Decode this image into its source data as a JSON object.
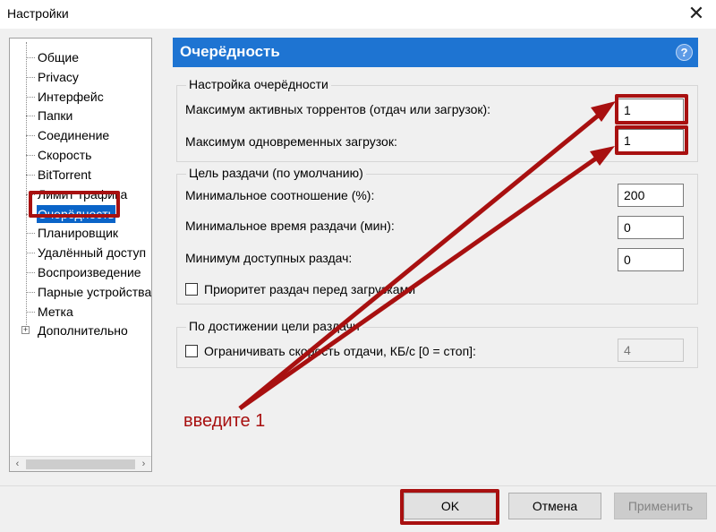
{
  "window": {
    "title": "Настройки",
    "close_glyph": "✕"
  },
  "tree": {
    "items": [
      {
        "label": "Общие",
        "selected": false
      },
      {
        "label": "Privacy",
        "selected": false
      },
      {
        "label": "Интерфейс",
        "selected": false
      },
      {
        "label": "Папки",
        "selected": false
      },
      {
        "label": "Соединение",
        "selected": false
      },
      {
        "label": "Скорость",
        "selected": false
      },
      {
        "label": "BitTorrent",
        "selected": false
      },
      {
        "label": "Лимит трафика",
        "selected": false
      },
      {
        "label": "Очерёдность",
        "selected": true
      },
      {
        "label": "Планировщик",
        "selected": false
      },
      {
        "label": "Удалённый доступ",
        "selected": false
      },
      {
        "label": "Воспроизведение",
        "selected": false
      },
      {
        "label": "Парные устройства",
        "selected": false
      },
      {
        "label": "Метка",
        "selected": false
      },
      {
        "label": "Дополнительно",
        "selected": false,
        "expander": "+"
      }
    ],
    "scroll_left": "‹",
    "scroll_right": "›"
  },
  "header": {
    "title": "Очерёдность",
    "help": "?"
  },
  "queue_group": {
    "title": "Настройка очерёдности",
    "max_active_label": "Максимум активных торрентов (отдач или загрузок):",
    "max_active_value": "1",
    "max_downloads_label": "Максимум одновременных загрузок:",
    "max_downloads_value": "1"
  },
  "seed_goal_group": {
    "title": "Цель раздачи (по умолчанию)",
    "min_ratio_label": "Минимальное соотношение (%):",
    "min_ratio_value": "200",
    "min_time_label": "Минимальное время раздачи (мин):",
    "min_time_value": "0",
    "min_seeds_label": "Минимум доступных раздач:",
    "min_seeds_value": "0",
    "priority_label": "Приоритет раздач перед загрузками",
    "priority_checked": false
  },
  "goal_reached_group": {
    "title": "По достижении цели раздачи",
    "limit_label": "Ограничивать скорость отдачи, КБ/с [0 = стоп]:",
    "limit_checked": false,
    "limit_value": "4"
  },
  "buttons": {
    "ok": "OK",
    "cancel": "Отмена",
    "apply": "Применить"
  },
  "annotation": {
    "text": "введите 1",
    "color": "#a81010"
  },
  "colors": {
    "accent": "#1e74d2",
    "selection": "#0a64c8",
    "annotation": "#a81010"
  }
}
